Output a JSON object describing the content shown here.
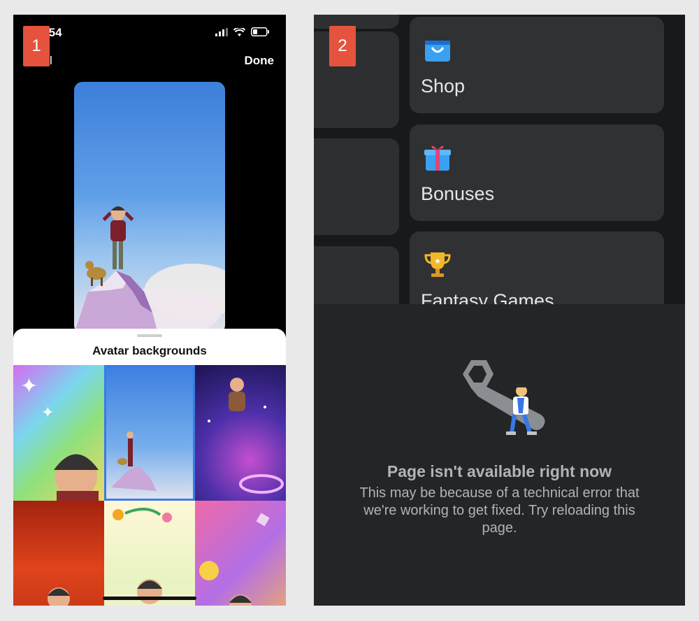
{
  "panel1": {
    "badge": "1",
    "status": {
      "time": ":54"
    },
    "nav": {
      "cancel_label": "cel",
      "done_label": "Done"
    },
    "sheet": {
      "title": "Avatar backgrounds"
    }
  },
  "panel2": {
    "badge": "2",
    "menu": {
      "items": [
        {
          "label": "Shop",
          "icon": "shopping-bag-icon"
        },
        {
          "label": "Bonuses",
          "icon": "gift-icon"
        },
        {
          "label": "Fantasy Games",
          "icon": "trophy-icon"
        }
      ]
    },
    "error": {
      "title": "Page isn't available right now",
      "message": "This may be because of a technical error that we're working to get fixed. Try reloading this page."
    }
  },
  "colors": {
    "badge": "#e5533d",
    "selection": "#3a7be6",
    "dark_bg": "#18191a",
    "card_bg": "#303132"
  }
}
